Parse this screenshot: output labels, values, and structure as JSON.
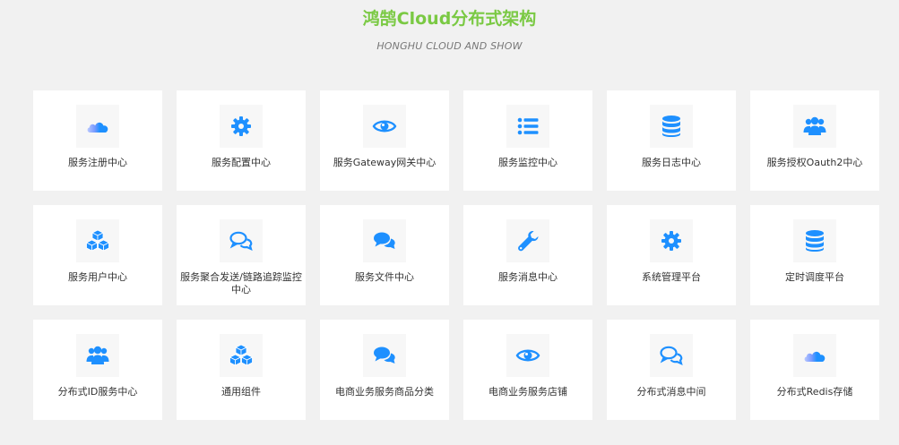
{
  "header": {
    "title": "鸿鹄Cloud分布式架构",
    "subtitle": "HONGHU CLOUD AND SHOW"
  },
  "colors": {
    "title": "#7ac943",
    "icon": "#1e90ff",
    "background": "#f1f1f1",
    "card": "#ffffff"
  },
  "services": [
    {
      "label": "服务注册中心",
      "icon": "cloud-icon"
    },
    {
      "label": "服务配置中心",
      "icon": "gear-icon"
    },
    {
      "label": "服务Gateway网关中心",
      "icon": "eye-icon"
    },
    {
      "label": "服务监控中心",
      "icon": "list-icon"
    },
    {
      "label": "服务日志中心",
      "icon": "database-icon"
    },
    {
      "label": "服务授权Oauth2中心",
      "icon": "users-icon"
    },
    {
      "label": "服务用户中心",
      "icon": "cubes-icon"
    },
    {
      "label": "服务聚合发送/链路追踪监控中心",
      "icon": "comments-outline-icon"
    },
    {
      "label": "服务文件中心",
      "icon": "comments-icon"
    },
    {
      "label": "服务消息中心",
      "icon": "wrench-icon"
    },
    {
      "label": "系统管理平台",
      "icon": "gear-icon"
    },
    {
      "label": "定时调度平台",
      "icon": "database-icon"
    },
    {
      "label": "分布式ID服务中心",
      "icon": "users-icon"
    },
    {
      "label": "通用组件",
      "icon": "cubes-icon"
    },
    {
      "label": "电商业务服务商品分类",
      "icon": "comments-icon"
    },
    {
      "label": "电商业务服务店铺",
      "icon": "eye-icon"
    },
    {
      "label": "分布式消息中间",
      "icon": "comments-outline-icon"
    },
    {
      "label": "分布式Redis存储",
      "icon": "cloud-icon"
    }
  ]
}
